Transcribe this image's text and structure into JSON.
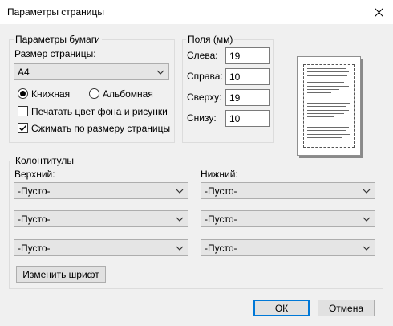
{
  "window": {
    "title": "Параметры страницы"
  },
  "paper": {
    "legend": "Параметры бумаги",
    "size_label": "Размер страницы:",
    "size_value": "A4",
    "orientation": {
      "portrait": "Книжная",
      "landscape": "Альбомная",
      "selected": "portrait"
    },
    "print_background": {
      "label": "Печатать цвет фона и рисунки",
      "checked": false
    },
    "shrink_to_fit": {
      "label": "Сжимать по размеру страницы",
      "checked": true
    }
  },
  "margins": {
    "legend": "Поля (мм)",
    "left": {
      "label": "Слева:",
      "value": "19"
    },
    "right": {
      "label": "Справа:",
      "value": "10"
    },
    "top": {
      "label": "Сверху:",
      "value": "19"
    },
    "bottom": {
      "label": "Снизу:",
      "value": "10"
    }
  },
  "headers_footers": {
    "legend": "Колонтитулы",
    "header_label": "Верхний:",
    "footer_label": "Нижний:",
    "header": [
      "-Пусто-",
      "-Пусто-",
      "-Пусто-"
    ],
    "footer": [
      "-Пусто-",
      "-Пусто-",
      "-Пусто-"
    ],
    "font_button": "Изменить шрифт"
  },
  "buttons": {
    "ok": "ОК",
    "cancel": "Отмена"
  },
  "colors": {
    "accent": "#0078d7",
    "window_bg": "#f0f0f0"
  }
}
